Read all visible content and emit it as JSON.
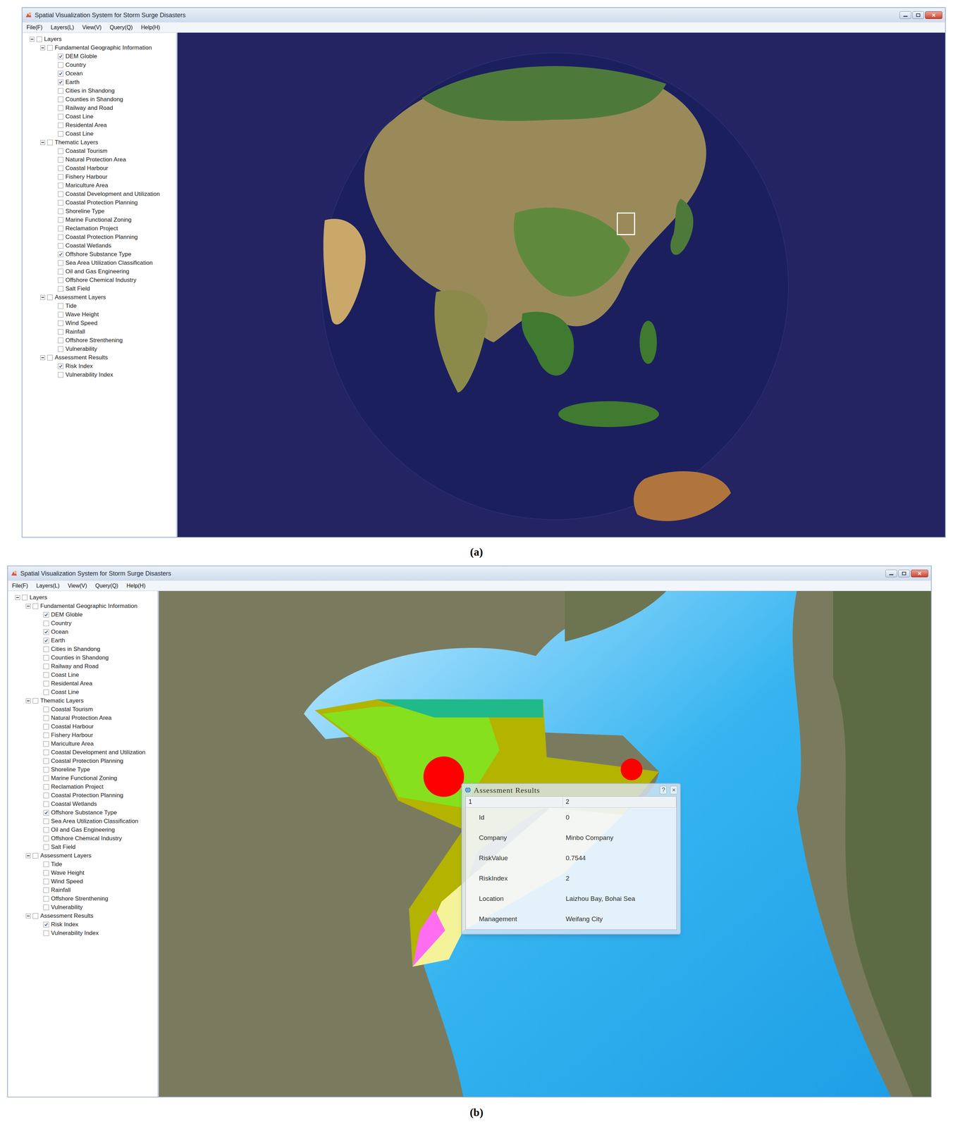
{
  "figures": [
    {
      "caption": "(a)",
      "window": {
        "title": "Spatial Visualization System for Storm Surge Disasters",
        "menu": [
          "File(F)",
          "Layers(L)",
          "View(V)",
          "Query(Q)",
          "Help(H)"
        ],
        "tree": {
          "label": "Layers",
          "checked": false,
          "expanded": true,
          "children": [
            {
              "label": "Fundamental Geographic Information",
              "checked": false,
              "expanded": true,
              "children": [
                {
                  "label": "DEM Globle",
                  "checked": true
                },
                {
                  "label": "Country",
                  "checked": false
                },
                {
                  "label": "Ocean",
                  "checked": true
                },
                {
                  "label": "Earth",
                  "checked": true
                },
                {
                  "label": "Cities in Shandong",
                  "checked": false
                },
                {
                  "label": "Counties in Shandong",
                  "checked": false
                },
                {
                  "label": "Railway and Road",
                  "checked": false
                },
                {
                  "label": "Coast Line",
                  "checked": false
                },
                {
                  "label": "Residental Area",
                  "checked": false
                },
                {
                  "label": "Coast Line",
                  "checked": false
                }
              ]
            },
            {
              "label": "Thematic Layers",
              "checked": false,
              "expanded": true,
              "children": [
                {
                  "label": "Coastal Tourism",
                  "checked": false
                },
                {
                  "label": "Natural Protection Area",
                  "checked": false
                },
                {
                  "label": "Coastal Harbour",
                  "checked": false
                },
                {
                  "label": "Fishery Harbour",
                  "checked": false
                },
                {
                  "label": "Mariculture Area",
                  "checked": false
                },
                {
                  "label": "Coastal Development and Utilization",
                  "checked": false
                },
                {
                  "label": "Coastal Protection Planning",
                  "checked": false
                },
                {
                  "label": "Shoreline Type",
                  "checked": false
                },
                {
                  "label": "Marine Functional Zoning",
                  "checked": false
                },
                {
                  "label": "Reclamation Project",
                  "checked": false
                },
                {
                  "label": "Coastal Protection Planning",
                  "checked": false
                },
                {
                  "label": "Coastal Wetlands",
                  "checked": false
                },
                {
                  "label": "Offshore Substance Type",
                  "checked": true
                },
                {
                  "label": "Sea Area Utilization Classification",
                  "checked": false
                },
                {
                  "label": "Oil and Gas Engineering",
                  "checked": false
                },
                {
                  "label": "Offshore Chemical Industry",
                  "checked": false
                },
                {
                  "label": "Salt Field",
                  "checked": false
                }
              ]
            },
            {
              "label": "Assessment Layers",
              "checked": false,
              "expanded": true,
              "children": [
                {
                  "label": "Tide",
                  "checked": false
                },
                {
                  "label": "Wave Height",
                  "checked": false
                },
                {
                  "label": "Wind Speed",
                  "checked": false
                },
                {
                  "label": "Rainfall",
                  "checked": false
                },
                {
                  "label": "Offshore Strenthening",
                  "checked": false
                },
                {
                  "label": "Vulnerability",
                  "checked": false
                }
              ]
            },
            {
              "label": "Assessment Results",
              "checked": false,
              "expanded": true,
              "children": [
                {
                  "label": "Risk Index",
                  "checked": true
                },
                {
                  "label": "Vulnerability Index",
                  "checked": false
                }
              ]
            }
          ]
        },
        "view": {
          "kind": "globe"
        }
      }
    },
    {
      "caption": "(b)",
      "window": {
        "title": "Spatial Visualization System for Storm Surge Disasters",
        "menu": [
          "File(F)",
          "Layers(L)",
          "View(V)",
          "Query(Q)",
          "Help(H)"
        ],
        "tree": {
          "label": "Layers",
          "checked": false,
          "expanded": true,
          "children": [
            {
              "label": "Fundamental Geographic Information",
              "checked": false,
              "expanded": true,
              "children": [
                {
                  "label": "DEM Globle",
                  "checked": true
                },
                {
                  "label": "Country",
                  "checked": false
                },
                {
                  "label": "Ocean",
                  "checked": true
                },
                {
                  "label": "Earth",
                  "checked": true
                },
                {
                  "label": "Cities in Shandong",
                  "checked": false
                },
                {
                  "label": "Counties in Shandong",
                  "checked": false
                },
                {
                  "label": "Railway and Road",
                  "checked": false
                },
                {
                  "label": "Coast Line",
                  "checked": false
                },
                {
                  "label": "Residental Area",
                  "checked": false
                },
                {
                  "label": "Coast Line",
                  "checked": false
                }
              ]
            },
            {
              "label": "Thematic Layers",
              "checked": false,
              "expanded": true,
              "children": [
                {
                  "label": "Coastal Tourism",
                  "checked": false
                },
                {
                  "label": "Natural Protection Area",
                  "checked": false
                },
                {
                  "label": "Coastal Harbour",
                  "checked": false
                },
                {
                  "label": "Fishery Harbour",
                  "checked": false
                },
                {
                  "label": "Mariculture Area",
                  "checked": false
                },
                {
                  "label": "Coastal Development and Utilization",
                  "checked": false
                },
                {
                  "label": "Coastal Protection Planning",
                  "checked": false
                },
                {
                  "label": "Shoreline Type",
                  "checked": false
                },
                {
                  "label": "Marine Functional Zoning",
                  "checked": false
                },
                {
                  "label": "Reclamation Project",
                  "checked": false
                },
                {
                  "label": "Coastal Protection Planning",
                  "checked": false
                },
                {
                  "label": "Coastal Wetlands",
                  "checked": false
                },
                {
                  "label": "Offshore Substance Type",
                  "checked": true
                },
                {
                  "label": "Sea Area Utilization Classification",
                  "checked": false
                },
                {
                  "label": "Oil and Gas Engineering",
                  "checked": false
                },
                {
                  "label": "Offshore Chemical Industry",
                  "checked": false
                },
                {
                  "label": "Salt Field",
                  "checked": false
                }
              ]
            },
            {
              "label": "Assessment Layers",
              "checked": false,
              "expanded": true,
              "children": [
                {
                  "label": "Tide",
                  "checked": false
                },
                {
                  "label": "Wave Height",
                  "checked": false
                },
                {
                  "label": "Wind Speed",
                  "checked": false
                },
                {
                  "label": "Rainfall",
                  "checked": false
                },
                {
                  "label": "Offshore Strenthening",
                  "checked": false
                },
                {
                  "label": "Vulnerability",
                  "checked": false
                }
              ]
            },
            {
              "label": "Assessment Results",
              "checked": false,
              "expanded": true,
              "children": [
                {
                  "label": "Risk Index",
                  "checked": true
                },
                {
                  "label": "Vulnerability Index",
                  "checked": false
                }
              ]
            }
          ]
        },
        "view": {
          "kind": "map"
        },
        "dialog": {
          "title": "Assessment Results",
          "buttons": [
            "?",
            "×"
          ],
          "columns": [
            "1",
            "2"
          ],
          "rows": [
            {
              "field": "Id",
              "value": "0"
            },
            {
              "field": "Company",
              "value": "Minbo Company"
            },
            {
              "field": "RiskValue",
              "value": "0.7544"
            },
            {
              "field": "RiskIndex",
              "value": "2"
            },
            {
              "field": "Location",
              "value": "Laizhou Bay, Bohai Sea"
            },
            {
              "field": "Management",
              "value": "Weifang City"
            }
          ]
        }
      }
    }
  ]
}
